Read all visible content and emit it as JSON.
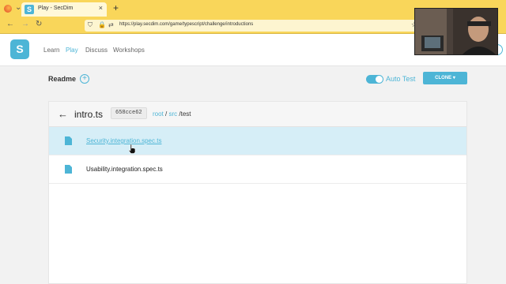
{
  "browser": {
    "tab_title": "Play - SecDim",
    "url": "https://play.secdim.com/game/typescript/challenge/introductions",
    "tab_favicon_letter": "S",
    "tab_close_glyph": "×",
    "new_tab_glyph": "+",
    "tab_list_glyph": "⌄"
  },
  "header": {
    "logo_letter": "S",
    "nav": [
      "Learn",
      "Play",
      "Discuss",
      "Workshops"
    ],
    "active_nav": "Play"
  },
  "readme": {
    "label": "Readme",
    "add_glyph": "+"
  },
  "autotest": {
    "label": "Auto Test",
    "enabled": true
  },
  "clone": {
    "label": "CLONE ▾"
  },
  "panel": {
    "file_title": "intro.ts",
    "commit": "658cce62",
    "breadcrumb": [
      {
        "label": "root",
        "link": true
      },
      {
        "label": " / ",
        "link": false
      },
      {
        "label": "src",
        "link": true
      },
      {
        "label": " /",
        "link": false
      },
      {
        "label": "test",
        "link": false
      }
    ],
    "files": [
      {
        "name": "Security.integration.spec.ts",
        "selected": true
      },
      {
        "name": "Usability.integration.spec.ts",
        "selected": false
      }
    ]
  },
  "colors": {
    "accent": "#4db5d6",
    "browser_chrome": "#f9d65a",
    "selected_row": "#d6eef7"
  }
}
